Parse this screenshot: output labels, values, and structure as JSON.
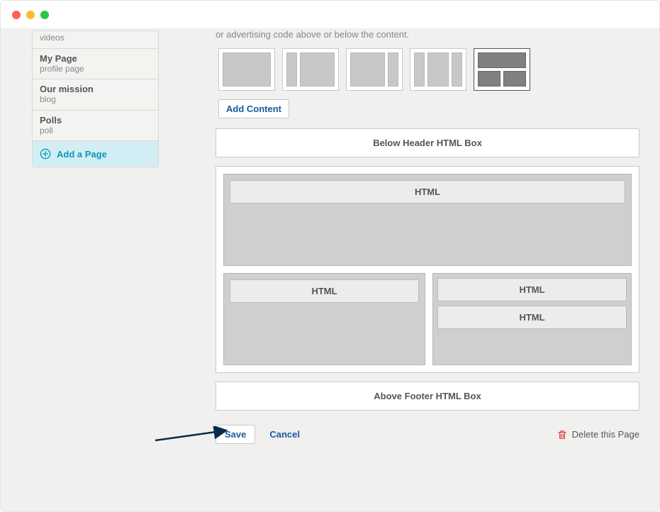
{
  "sidebar": {
    "items": [
      {
        "title": "",
        "subtitle": "videos"
      },
      {
        "title": "My Page",
        "subtitle": "profile page"
      },
      {
        "title": "Our mission",
        "subtitle": "blog"
      },
      {
        "title": "Polls",
        "subtitle": "poll"
      }
    ],
    "add_label": "Add a Page"
  },
  "main": {
    "hint": "or advertising code above or below the content.",
    "add_content": "Add Content",
    "below_header_box": "Below Header HTML Box",
    "above_footer_box": "Above Footer HTML Box",
    "html_block_label": "HTML"
  },
  "actions": {
    "save": "Save",
    "cancel": "Cancel",
    "delete": "Delete this Page"
  }
}
